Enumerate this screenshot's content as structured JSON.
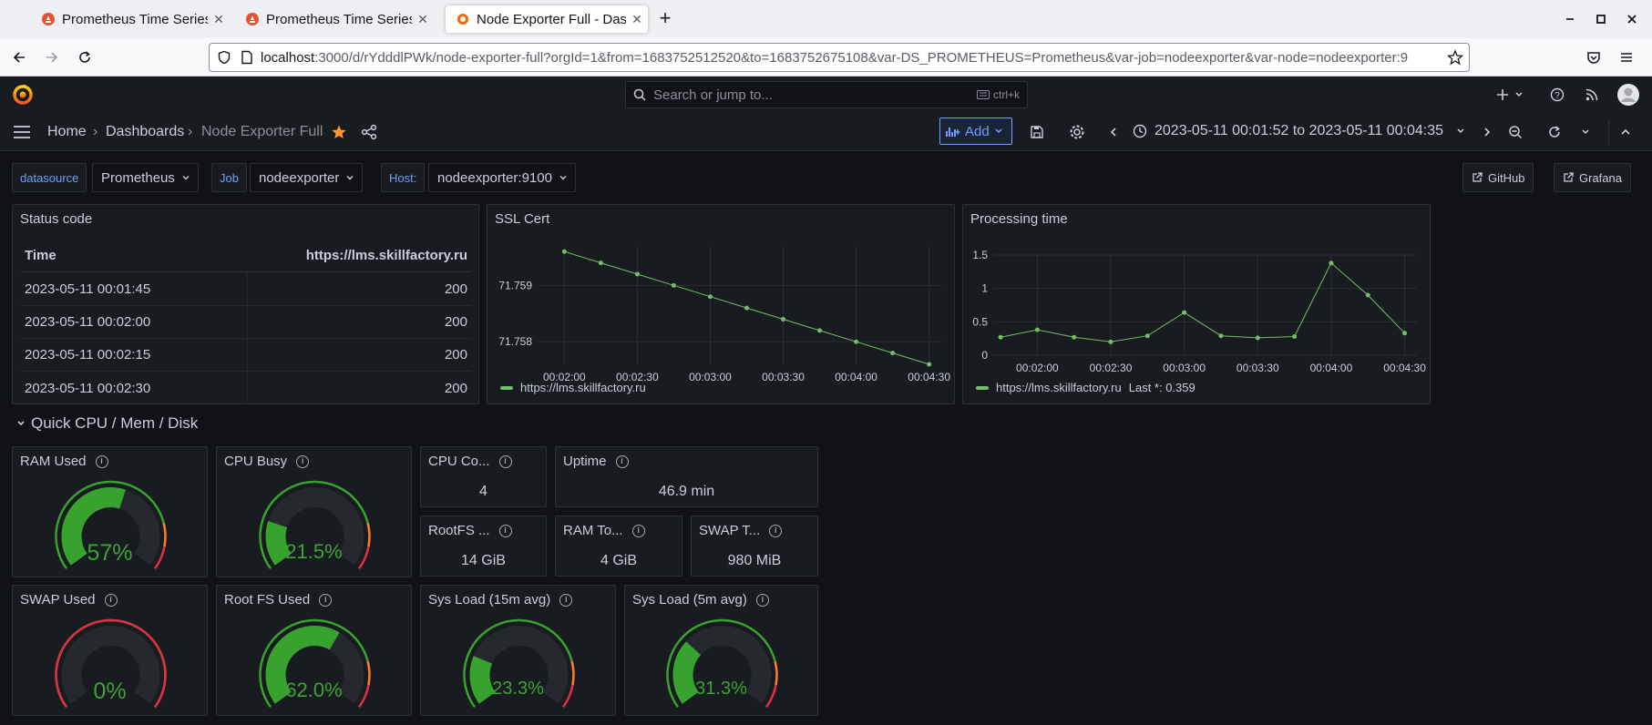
{
  "browser": {
    "tabs": [
      {
        "label": "Prometheus Time Series C"
      },
      {
        "label": "Prometheus Time Series C"
      },
      {
        "label": "Node Exporter Full - Dash"
      }
    ],
    "url_host": "localhost",
    "url_rest": ":3000/d/rYdddlPWk/node-exporter-full?orgId=1&from=1683752512520&to=1683752675108&var-DS_PROMETHEUS=Prometheus&var-job=nodeexporter&var-node=nodeexporter:9"
  },
  "grafana": {
    "search_placeholder": "Search or jump to...",
    "search_shortcut": "ctrl+k",
    "breadcrumbs": [
      "Home",
      "Dashboards",
      "Node Exporter Full"
    ],
    "add_label": "Add",
    "time_range": "2023-05-11 00:01:52 to 2023-05-11 00:04:35"
  },
  "variables": {
    "datasource_label": "datasource",
    "datasource_value": "Prometheus",
    "job_label": "Job",
    "job_value": "nodeexporter",
    "host_label": "Host:",
    "host_value": "nodeexporter:9100",
    "github_label": "GitHub",
    "grafana_label": "Grafana"
  },
  "status_panel": {
    "title": "Status code",
    "col_time": "Time",
    "col_url": "https://lms.skillfactory.ru",
    "rows": [
      {
        "time": "2023-05-11 00:01:45",
        "value": "200"
      },
      {
        "time": "2023-05-11 00:02:00",
        "value": "200"
      },
      {
        "time": "2023-05-11 00:02:15",
        "value": "200"
      },
      {
        "time": "2023-05-11 00:02:30",
        "value": "200"
      }
    ]
  },
  "row_header": "Quick CPU / Mem / Disk",
  "stats": {
    "ram_used": {
      "title": "RAM Used",
      "value": "57%",
      "fraction": 0.57
    },
    "cpu_busy": {
      "title": "CPU Busy",
      "value": "21.5%",
      "fraction": 0.215
    },
    "swap_used": {
      "title": "SWAP Used",
      "value": "0%",
      "fraction": 0
    },
    "root_fs_used": {
      "title": "Root FS Used",
      "value": "62.0%",
      "fraction": 0.62
    },
    "sys_load_15": {
      "title": "Sys Load (15m avg)",
      "value": "23.3%",
      "fraction": 0.233
    },
    "sys_load_5": {
      "title": "Sys Load (5m avg)",
      "value": "31.3%",
      "fraction": 0.313
    },
    "cpu_cores": {
      "title": "CPU Co...",
      "value": "4"
    },
    "uptime": {
      "title": "Uptime",
      "value": "46.9 min"
    },
    "rootfs_total": {
      "title": "RootFS ...",
      "value": "14 GiB"
    },
    "ram_total": {
      "title": "RAM To...",
      "value": "4 GiB"
    },
    "swap_total": {
      "title": "SWAP T...",
      "value": "980 MiB"
    }
  },
  "colors": {
    "green": "#73bf69",
    "gauge_green": "#37a32e",
    "orange": "#ff7f2a",
    "red": "#e02f44",
    "accent": "#6e9fff"
  },
  "chart_data": [
    {
      "type": "line",
      "title": "SSL Cert",
      "x": [
        "00:02:00",
        "00:02:15",
        "00:02:30",
        "00:02:45",
        "00:03:00",
        "00:03:15",
        "00:03:30",
        "00:03:45",
        "00:04:00",
        "00:04:15",
        "00:04:30"
      ],
      "x_ticks": [
        "00:02:00",
        "00:02:30",
        "00:03:00",
        "00:03:30",
        "00:04:00",
        "00:04:30"
      ],
      "y_ticks": [
        "71.759",
        "71.758"
      ],
      "ylim": [
        71.7576,
        71.7597
      ],
      "series": [
        {
          "name": "https://lms.skillfactory.ru",
          "values": [
            71.7596,
            71.7594,
            71.7592,
            71.759,
            71.7588,
            71.7586,
            71.7584,
            71.7582,
            71.758,
            71.7578,
            71.7576
          ]
        }
      ],
      "legend": "bottom-left",
      "grid": true
    },
    {
      "type": "line",
      "title": "Processing time",
      "x": [
        "00:01:45",
        "00:02:00",
        "00:02:15",
        "00:02:30",
        "00:02:45",
        "00:03:00",
        "00:03:15",
        "00:03:30",
        "00:03:45",
        "00:04:00",
        "00:04:15",
        "00:04:30"
      ],
      "x_ticks": [
        "00:02:00",
        "00:02:30",
        "00:03:00",
        "00:03:30",
        "00:04:00",
        "00:04:30"
      ],
      "y_ticks": [
        "1.5",
        "1",
        "0.5",
        "0"
      ],
      "ylim": [
        0,
        1.5
      ],
      "series": [
        {
          "name": "https://lms.skillfactory.ru",
          "values": [
            0.27,
            0.38,
            0.27,
            0.2,
            0.29,
            0.64,
            0.29,
            0.26,
            0.28,
            1.38,
            0.9,
            0.33
          ]
        }
      ],
      "legend": "bottom-left",
      "legend_extra": "Last *: 0.359",
      "grid": true
    }
  ]
}
